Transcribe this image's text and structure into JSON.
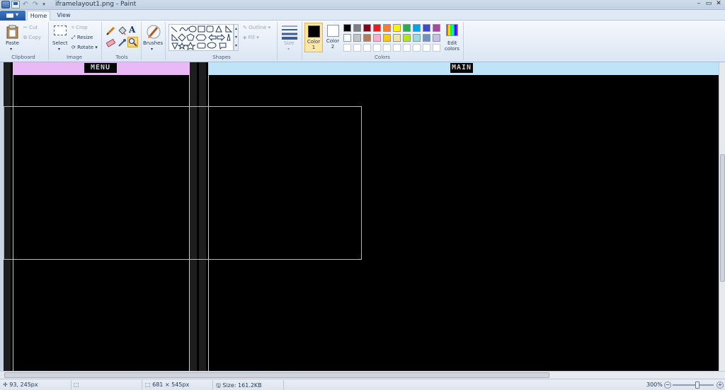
{
  "window": {
    "title": "iframelayout1.png - Paint"
  },
  "quick_access": {
    "icons": [
      "app-menu-icon",
      "save-icon",
      "undo-icon",
      "redo-icon",
      "customize-icon"
    ]
  },
  "tabs": [
    {
      "label": "Home",
      "active": true
    },
    {
      "label": "View",
      "active": false
    }
  ],
  "ribbon": {
    "clipboard": {
      "label": "Clipboard",
      "paste": "Paste",
      "cut": "Cut",
      "copy": "Copy"
    },
    "image": {
      "label": "Image",
      "select": "Select",
      "crop": "Crop",
      "resize": "Resize",
      "rotate": "Rotate"
    },
    "tools": {
      "label": "Tools"
    },
    "brushes": {
      "label": "Brushes"
    },
    "shapes": {
      "label": "Shapes",
      "outline": "Outline",
      "fill": "Fill"
    },
    "size": {
      "label": "Size"
    },
    "colors": {
      "label": "Colors",
      "color1": "Color\n1",
      "color1_line1": "Color",
      "color1_line2": "1",
      "color2_line1": "Color",
      "color2_line2": "2",
      "color1_value": "#000000",
      "color2_value": "#ffffff",
      "edit_line1": "Edit",
      "edit_line2": "colors",
      "palette_row1": [
        "#000000",
        "#7f7f7f",
        "#880015",
        "#ed1c24",
        "#ff7f27",
        "#fff200",
        "#22b14c",
        "#00a2e8",
        "#3f48cc",
        "#a349a4"
      ],
      "palette_row2": [
        "#ffffff",
        "#c3c3c3",
        "#b97a57",
        "#ffaec9",
        "#ffc90e",
        "#efe4b0",
        "#b5e61d",
        "#99d9ea",
        "#7092be",
        "#c8bfe7"
      ],
      "palette_row3": [
        "#ffffff",
        "#ffffff",
        "#ffffff",
        "#ffffff",
        "#ffffff",
        "#ffffff",
        "#ffffff",
        "#ffffff",
        "#ffffff",
        "#ffffff"
      ]
    }
  },
  "canvas": {
    "menu_frame": {
      "label": "MENU",
      "header_color": "#e8b9f4"
    },
    "main_frame": {
      "label": "MAIN",
      "header_color": "#bfe3f7"
    },
    "background": "#000000"
  },
  "status": {
    "cursor_position": "93, 245px",
    "selection_size": "681 × 545px",
    "file_size": "Size: 161.2KB",
    "zoom": "300%"
  }
}
